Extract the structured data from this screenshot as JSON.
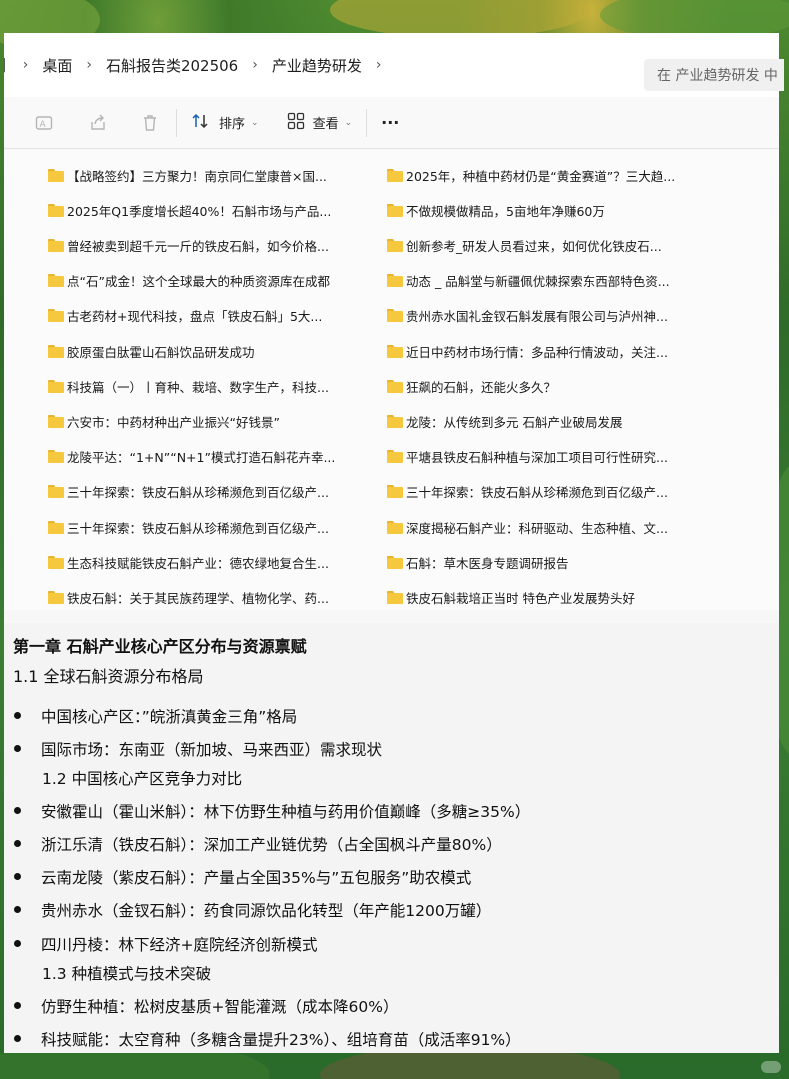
{
  "breadcrumb": {
    "items": [
      "桌面",
      "石斛报告类202506",
      "产业趋势研发"
    ],
    "separator": "›"
  },
  "search": {
    "placeholder": "在 产业趋势研发 中"
  },
  "toolbar": {
    "sort_label": "排序",
    "view_label": "查看",
    "more_label": "···"
  },
  "files": [
    "【战略签约】三方聚力！南京同仁堂康普×国...",
    "2025年，种植中药材仍是“黄金赛道”？三大趋...",
    "2025年Q1季度增长超40%！石斛市场与产品...",
    "不做规模做精品，5亩地年净赚60万",
    "曾经被卖到超千元一斤的铁皮石斛，如今价格...",
    "创新参考_研发人员看过来，如何优化铁皮石...",
    "点“石”成金！这个全球最大的种质资源库在成都",
    "动态 _ 品斛堂与新疆佩优棘探索东西部特色资...",
    "古老药材+现代科技，盘点「铁皮石斛」5大...",
    "贵州赤水国礼金钗石斛发展有限公司与泸州神...",
    "胶原蛋白肽霍山石斛饮品研发成功",
    "近日中药材市场行情：多品种行情波动，关注...",
    "科技篇（一）丨育种、栽培、数字生产，科技...",
    "狂飙的石斛，还能火多久？",
    "六安市：中药材种出产业振兴“好钱景”",
    "龙陵：从传统到多元 石斛产业破局发展",
    "龙陵平达：“1+N”“N+1”模式打造石斛花卉幸...",
    "平塘县铁皮石斛种植与深加工项目可行性研究...",
    "三十年探索：铁皮石斛从珍稀濒危到百亿级产...",
    "三十年探索：铁皮石斛从珍稀濒危到百亿级产...",
    "三十年探索：铁皮石斛从珍稀濒危到百亿级产...",
    "深度揭秘石斛产业：科研驱动、生态种植、文...",
    "生态科技赋能铁皮石斛产业：德农绿地复合生...",
    "石斛：草木医身专题调研报告",
    "铁皮石斛：关于其民族药理学、植物化学、药...",
    "铁皮石斛栽培正当时 特色产业发展势头好"
  ],
  "article": {
    "chapter_title": "第一章 石斛产业核心产区分布与资源禀赋",
    "section_1_1": "1.1 全球石斛资源分布格局",
    "bullets": [
      "中国核心产区：”皖浙滇黄金三角”格局",
      "国际市场：东南亚（新加坡、马来西亚）需求现状",
      "安徽霍山（霍山米斛）：林下仿野生种植与药用价值巅峰（多糖≥35%）",
      "浙江乐清（铁皮石斛）：深加工产业链优势（占全国枫斗产量80%）",
      "云南龙陵（紫皮石斛）：产量占全国35%与”五包服务”助农模式",
      "贵州赤水（金钗石斛）：药食同源饮品化转型（年产能1200万罐）",
      "四川丹棱：林下经济+庭院经济创新模式",
      "仿野生种植：松树皮基质+智能灌溉（成本降60%）",
      "科技赋能：太空育种（多糖含量提升23%）、组培育苗（成活率91%）"
    ],
    "section_1_2": "1.2 中国核心产区竞争力对比",
    "section_1_3": "1.3 种植模式与技术突破"
  },
  "colors": {
    "folder": "#f5c83e",
    "background_green": "#2e6b2c",
    "panel": "#f7f7f7"
  }
}
